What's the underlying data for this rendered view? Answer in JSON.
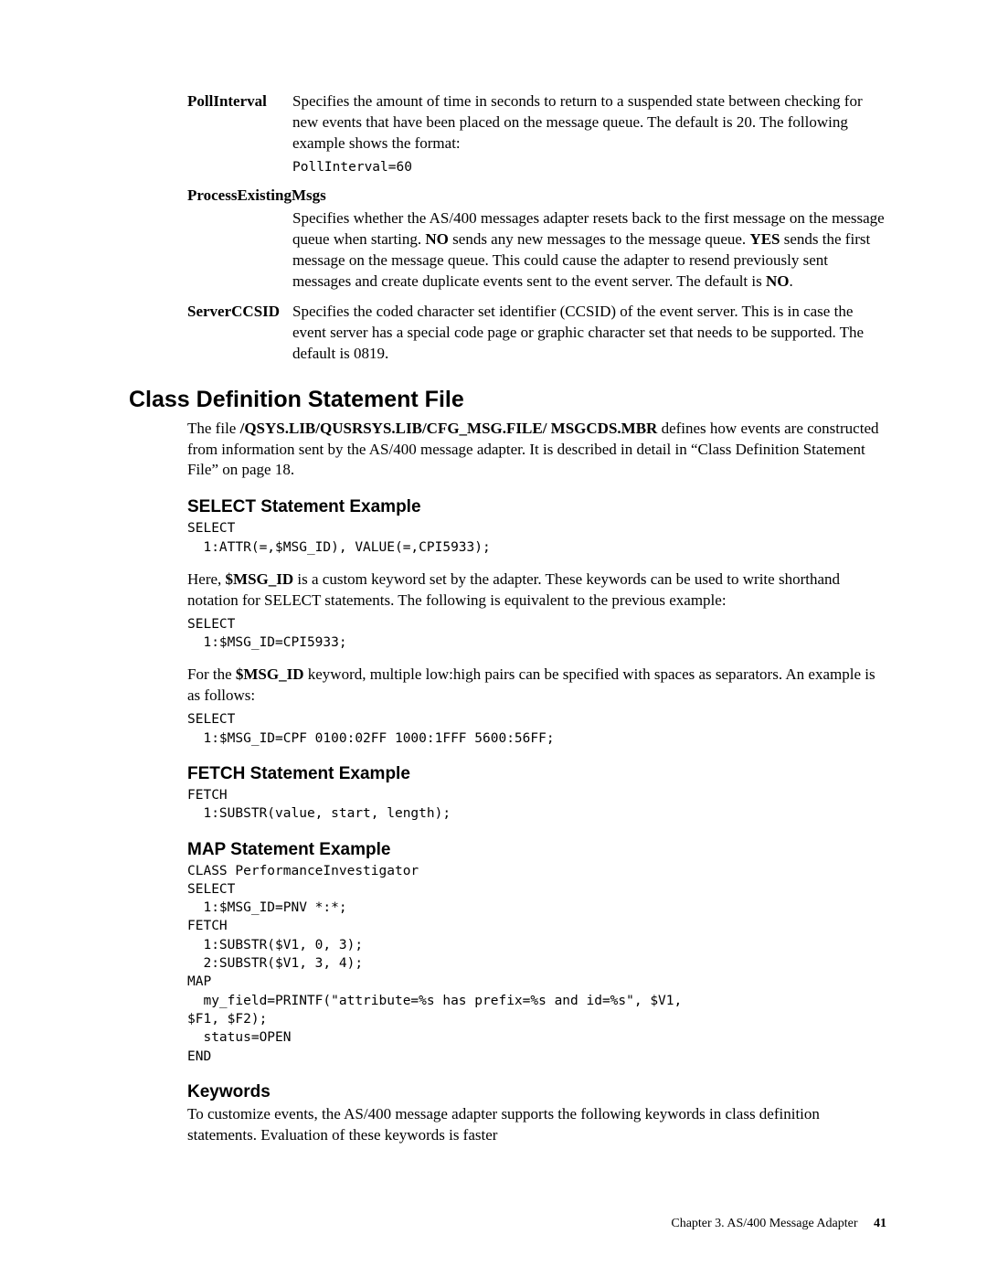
{
  "defs": {
    "poll": {
      "term": "PollInterval",
      "desc": "Specifies the amount of time in seconds to return to a suspended state between checking for new events that have been placed on the message queue. The default is 20. The following example shows the format:",
      "code": "PollInterval=60"
    },
    "proc": {
      "term": "ProcessExistingMsgs",
      "desc_pre": "Specifies whether the AS/400 messages adapter resets back to the first message on the message queue when starting. ",
      "no": "NO",
      "desc_mid": " sends any new messages to the message queue. ",
      "yes": "YES",
      "desc_post": " sends the first message on the message queue. This could cause the adapter to resend previously sent messages and create duplicate events sent to the event server. The default is ",
      "no2": "NO",
      "desc_end": "."
    },
    "ccsid": {
      "term": "ServerCCSID",
      "desc": "Specifies the coded character set identifier (CCSID) of the event server. This is in case the event server has a special code page or graphic character set that needs to be supported. The default is 0819."
    }
  },
  "h2": "Class Definition Statement File",
  "intro_pre": "The file ",
  "intro_bold": "/QSYS.LIB/QUSRSYS.LIB/CFG_MSG.FILE/ MSGCDS.MBR",
  "intro_post": " defines how events are constructed from information sent by the AS/400 message adapter. It is described in detail in “Class Definition Statement File” on page 18.",
  "select": {
    "heading": "SELECT Statement Example",
    "code1": "SELECT\n  1:ATTR(=,$MSG_ID), VALUE(=,CPI5933);",
    "para1_pre": "Here, ",
    "para1_bold": "$MSG_ID",
    "para1_post": " is a custom keyword set by the adapter. These keywords can be used to write shorthand notation for SELECT statements. The following is equivalent to the previous example:",
    "code2": "SELECT\n  1:$MSG_ID=CPI5933;",
    "para2_pre": "For the ",
    "para2_bold": "$MSG_ID",
    "para2_post": " keyword, multiple low:high pairs can be specified with spaces as separators. An example is as follows:",
    "code3": "SELECT\n  1:$MSG_ID=CPF 0100:02FF 1000:1FFF 5600:56FF;"
  },
  "fetch": {
    "heading": "FETCH Statement Example",
    "code": "FETCH\n  1:SUBSTR(value, start, length);"
  },
  "map": {
    "heading": "MAP Statement Example",
    "code": "CLASS PerformanceInvestigator\nSELECT\n  1:$MSG_ID=PNV *:*;\nFETCH\n  1:SUBSTR($V1, 0, 3);\n  2:SUBSTR($V1, 3, 4);\nMAP\n  my_field=PRINTF(\"attribute=%s has prefix=%s and id=%s\", $V1,\n$F1, $F2);\n  status=OPEN\nEND"
  },
  "keywords": {
    "heading": "Keywords",
    "para": "To customize events, the AS/400 message adapter supports the following keywords in class definition statements. Evaluation of these keywords is faster"
  },
  "footer": {
    "chapter": "Chapter 3. AS/400 Message Adapter",
    "page": "41"
  }
}
